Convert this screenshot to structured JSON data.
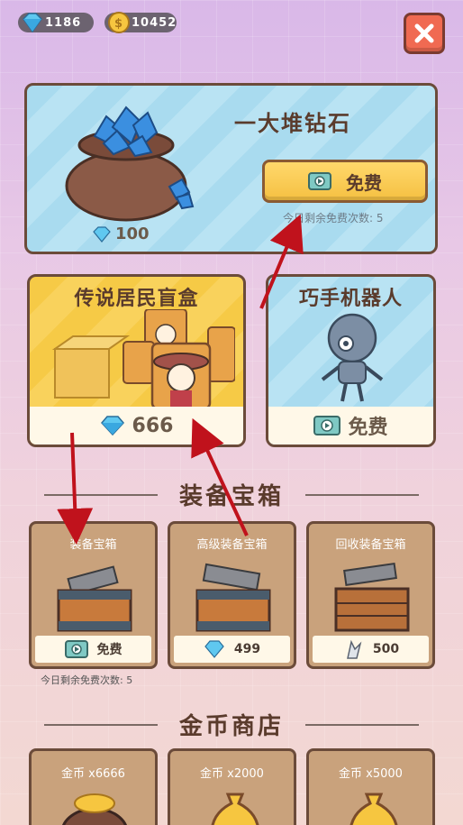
{
  "topbar": {
    "diamonds": "1186",
    "coins": "10452"
  },
  "hero": {
    "title": "一大堆钻石",
    "free_label": "免费",
    "remaining_text": "今日剩余免费次数: 5",
    "price": "100"
  },
  "blind_box": {
    "title": "传说居民盲盒",
    "price": "666"
  },
  "robot": {
    "title": "巧手机器人",
    "free_label": "免费"
  },
  "equipment_section": {
    "title": "装备宝箱",
    "chests": [
      {
        "title": "装备宝箱",
        "price": "免费"
      },
      {
        "title": "高级装备宝箱",
        "price": "499"
      },
      {
        "title": "回收装备宝箱",
        "price": "500"
      }
    ],
    "remaining_text": "今日剩余免费次数: 5"
  },
  "coin_section": {
    "title": "金币商店",
    "items": [
      {
        "title": "金币 x6666"
      },
      {
        "title": "金币 x2000"
      },
      {
        "title": "金币 x5000"
      }
    ]
  },
  "colors": {
    "accent_red": "#c0121c",
    "close_bg": "#f06a52",
    "button_gold": "#f5c042"
  }
}
